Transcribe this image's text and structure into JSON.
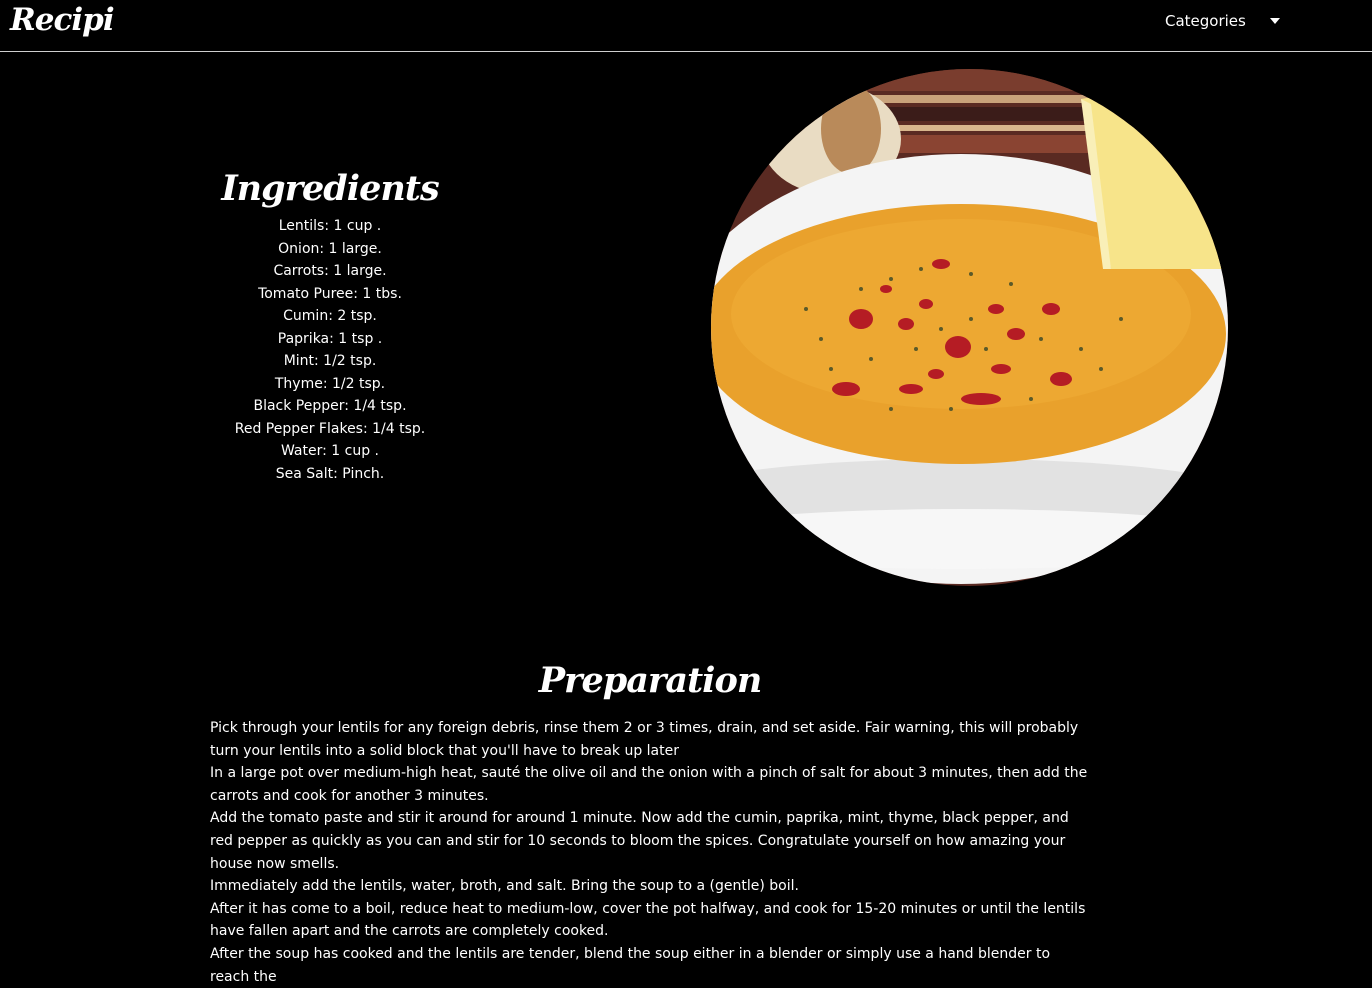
{
  "navbar": {
    "logo": "Recipi",
    "categories_label": "Categories",
    "caret_icon": "caret-down-icon"
  },
  "ingredients": {
    "heading": "Ingredients",
    "items": [
      "Lentils: 1 cup .",
      "Onion: 1 large.",
      "Carrots: 1 large.",
      "Tomato Puree: 1 tbs.",
      "Cumin: 2 tsp.",
      "Paprika: 1 tsp .",
      "Mint: 1/2 tsp.",
      "Thyme: 1/2 tsp.",
      "Black Pepper: 1/4 tsp.",
      "Red Pepper Flakes: 1/4 tsp.",
      "Water: 1 cup .",
      "Sea Salt: Pinch."
    ]
  },
  "dish_image": {
    "colors": {
      "soup": "#e9a12c",
      "bowl": "#f4f4f4",
      "sauce": "#b51c24",
      "lemon": "#f7e48a"
    }
  },
  "preparation": {
    "heading": "Preparation",
    "steps": [
      "Pick through your lentils for any foreign debris, rinse them 2 or 3 times, drain, and set aside. Fair warning, this will probably turn your lentils into a solid block that you'll have to break up later",
      "In a large pot over medium-high heat, sauté the olive oil and the onion with a pinch of salt for about 3 minutes, then add the carrots and cook for another 3 minutes.",
      "Add the tomato paste and stir it around for around 1 minute. Now add the cumin, paprika, mint, thyme, black pepper, and red pepper as quickly as you can and stir for 10 seconds to bloom the spices. Congratulate yourself on how amazing your house now smells.",
      "Immediately add the lentils, water, broth, and salt. Bring the soup to a (gentle) boil.",
      "After it has come to a boil, reduce heat to medium-low, cover the pot halfway, and cook for 15-20 minutes or until the lentils have fallen apart and the carrots are completely cooked.",
      "After the soup has cooked and the lentils are tender, blend the soup either in a blender or simply use a hand blender to reach the"
    ]
  }
}
